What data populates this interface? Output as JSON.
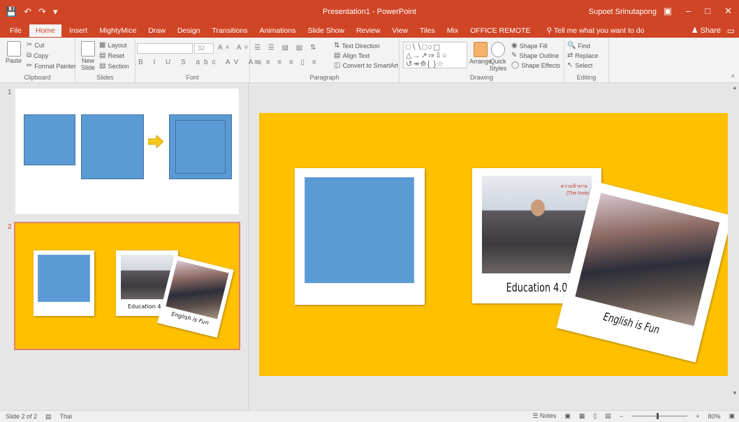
{
  "titlebar": {
    "title": "Presentation1 - PowerPoint",
    "user": "Supoet Srinutapong",
    "qat_icons": [
      "save-icon",
      "undo-icon",
      "redo-icon",
      "customize-icon"
    ],
    "accent_color": "#d04525"
  },
  "tabs": [
    {
      "label": "File"
    },
    {
      "label": "Home",
      "active": true
    },
    {
      "label": "Insert"
    },
    {
      "label": "MightyMice"
    },
    {
      "label": "Draw"
    },
    {
      "label": "Design"
    },
    {
      "label": "Transitions"
    },
    {
      "label": "Animations"
    },
    {
      "label": "Slide Show"
    },
    {
      "label": "Review"
    },
    {
      "label": "View"
    },
    {
      "label": "Tiles"
    },
    {
      "label": "Mix"
    },
    {
      "label": "OFFICE REMOTE"
    }
  ],
  "tell_me": "Tell me what you want to do",
  "share": "Share",
  "ribbon": {
    "clipboard": {
      "label": "Clipboard",
      "paste": "Paste",
      "cut": "Cut",
      "copy": "Copy",
      "format_painter": "Format Painter"
    },
    "slides": {
      "label": "Slides",
      "new_slide": "New Slide",
      "layout": "Layout",
      "reset": "Reset",
      "section": "Section"
    },
    "font": {
      "label": "Font",
      "size": "32"
    },
    "paragraph": {
      "label": "Paragraph",
      "text_direction": "Text Direction",
      "align_text": "Align Text",
      "convert_smartart": "Convert to SmartArt"
    },
    "drawing": {
      "label": "Drawing",
      "arrange": "Arrange",
      "quick_styles": "Quick Styles",
      "shape_fill": "Shape Fill",
      "shape_outline": "Shape Outline",
      "shape_effects": "Shape Effects"
    },
    "editing": {
      "label": "Editing",
      "find": "Find",
      "replace": "Replace",
      "select": "Select"
    }
  },
  "thumbnails": [
    {
      "number": "1",
      "selected": false
    },
    {
      "number": "2",
      "selected": true,
      "caption_a": "Education 4.0",
      "caption_b": "English is Fun"
    }
  ],
  "slide": {
    "background": "#ffc000",
    "caption_a": "Education 4.0",
    "caption_b": "English is Fun",
    "photo_sign": "ความท้าทาย",
    "photo_sign_sub": "(The Invisi"
  },
  "status": {
    "slide_info": "Slide 2 of 2",
    "language": "Thai",
    "notes": "Notes",
    "zoom": "80%"
  }
}
